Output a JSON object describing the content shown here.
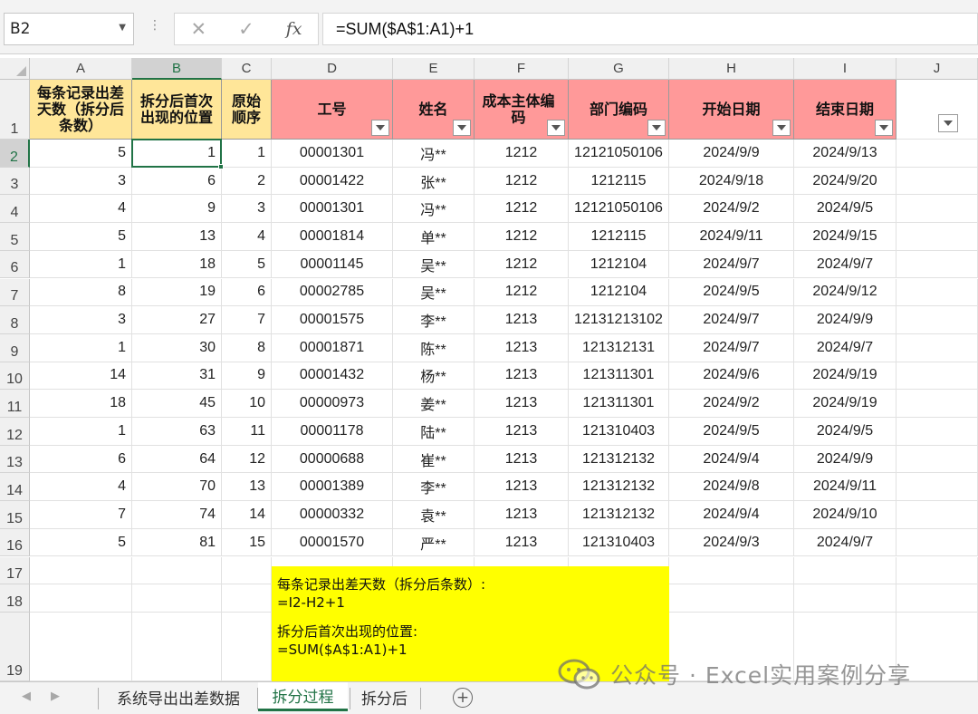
{
  "namebox": "B2",
  "formula": "=SUM($A$1:A1)+1",
  "columns": [
    "A",
    "B",
    "C",
    "D",
    "E",
    "F",
    "G",
    "H",
    "I",
    "J"
  ],
  "selected_column": "B",
  "selected_row": "2",
  "headers": {
    "A": "每条记录出差天数（拆分后条数）",
    "B": "拆分后首次出现的位置",
    "C": "原始顺序",
    "D": "工号",
    "E": "姓名",
    "F": "成本主体编码",
    "G": "部门编码",
    "H": "开始日期",
    "I": "结束日期"
  },
  "rows": [
    [
      "5",
      "1",
      "1",
      "00001301",
      "冯**",
      "1212",
      "12121050106",
      "2024/9/9",
      "2024/9/13"
    ],
    [
      "3",
      "6",
      "2",
      "00001422",
      "张**",
      "1212",
      "1212115",
      "2024/9/18",
      "2024/9/20"
    ],
    [
      "4",
      "9",
      "3",
      "00001301",
      "冯**",
      "1212",
      "12121050106",
      "2024/9/2",
      "2024/9/5"
    ],
    [
      "5",
      "13",
      "4",
      "00001814",
      "单**",
      "1212",
      "1212115",
      "2024/9/11",
      "2024/9/15"
    ],
    [
      "1",
      "18",
      "5",
      "00001145",
      "吴**",
      "1212",
      "1212104",
      "2024/9/7",
      "2024/9/7"
    ],
    [
      "8",
      "19",
      "6",
      "00002785",
      "吴**",
      "1212",
      "1212104",
      "2024/9/5",
      "2024/9/12"
    ],
    [
      "3",
      "27",
      "7",
      "00001575",
      "李**",
      "1213",
      "12131213102",
      "2024/9/7",
      "2024/9/9"
    ],
    [
      "1",
      "30",
      "8",
      "00001871",
      "陈**",
      "1213",
      "121312131",
      "2024/9/7",
      "2024/9/7"
    ],
    [
      "14",
      "31",
      "9",
      "00001432",
      "杨**",
      "1213",
      "121311301",
      "2024/9/6",
      "2024/9/19"
    ],
    [
      "18",
      "45",
      "10",
      "00000973",
      "姜**",
      "1213",
      "121311301",
      "2024/9/2",
      "2024/9/19"
    ],
    [
      "1",
      "63",
      "11",
      "00001178",
      "陆**",
      "1213",
      "121310403",
      "2024/9/5",
      "2024/9/5"
    ],
    [
      "6",
      "64",
      "12",
      "00000688",
      "崔**",
      "1213",
      "121312132",
      "2024/9/4",
      "2024/9/9"
    ],
    [
      "4",
      "70",
      "13",
      "00001389",
      "李**",
      "1213",
      "121312132",
      "2024/9/8",
      "2024/9/11"
    ],
    [
      "7",
      "74",
      "14",
      "00000332",
      "袁**",
      "1213",
      "121312132",
      "2024/9/4",
      "2024/9/10"
    ],
    [
      "5",
      "81",
      "15",
      "00001570",
      "严**",
      "1213",
      "121310403",
      "2024/9/3",
      "2024/9/7"
    ]
  ],
  "row_numbers": [
    "1",
    "2",
    "3",
    "4",
    "5",
    "6",
    "7",
    "8",
    "9",
    "10",
    "11",
    "12",
    "13",
    "14",
    "15",
    "16",
    "17",
    "18",
    "19"
  ],
  "note": {
    "line1": "每条记录出差天数（拆分后条数）:",
    "line2": "=I2-H2+1",
    "line3": "拆分后首次出现的位置:",
    "line4": "=SUM($A$1:A1)+1"
  },
  "sheet_tabs": [
    {
      "label": "系统导出出差数据",
      "active": false
    },
    {
      "label": "拆分过程",
      "active": true
    },
    {
      "label": "拆分后",
      "active": false
    }
  ],
  "add_sheet_label": "+",
  "watermark": "公众号 · Excel实用案例分享",
  "colors": {
    "accent": "#217346",
    "header_yellow": "#ffe699",
    "header_pink": "#ff9999",
    "note_bg": "#ffff00"
  },
  "icons": [
    "dropdown-arrow-icon",
    "cancel-icon",
    "confirm-icon",
    "fx-icon",
    "filter-dropdown-icon",
    "add-sheet-icon",
    "wechat-icon"
  ]
}
